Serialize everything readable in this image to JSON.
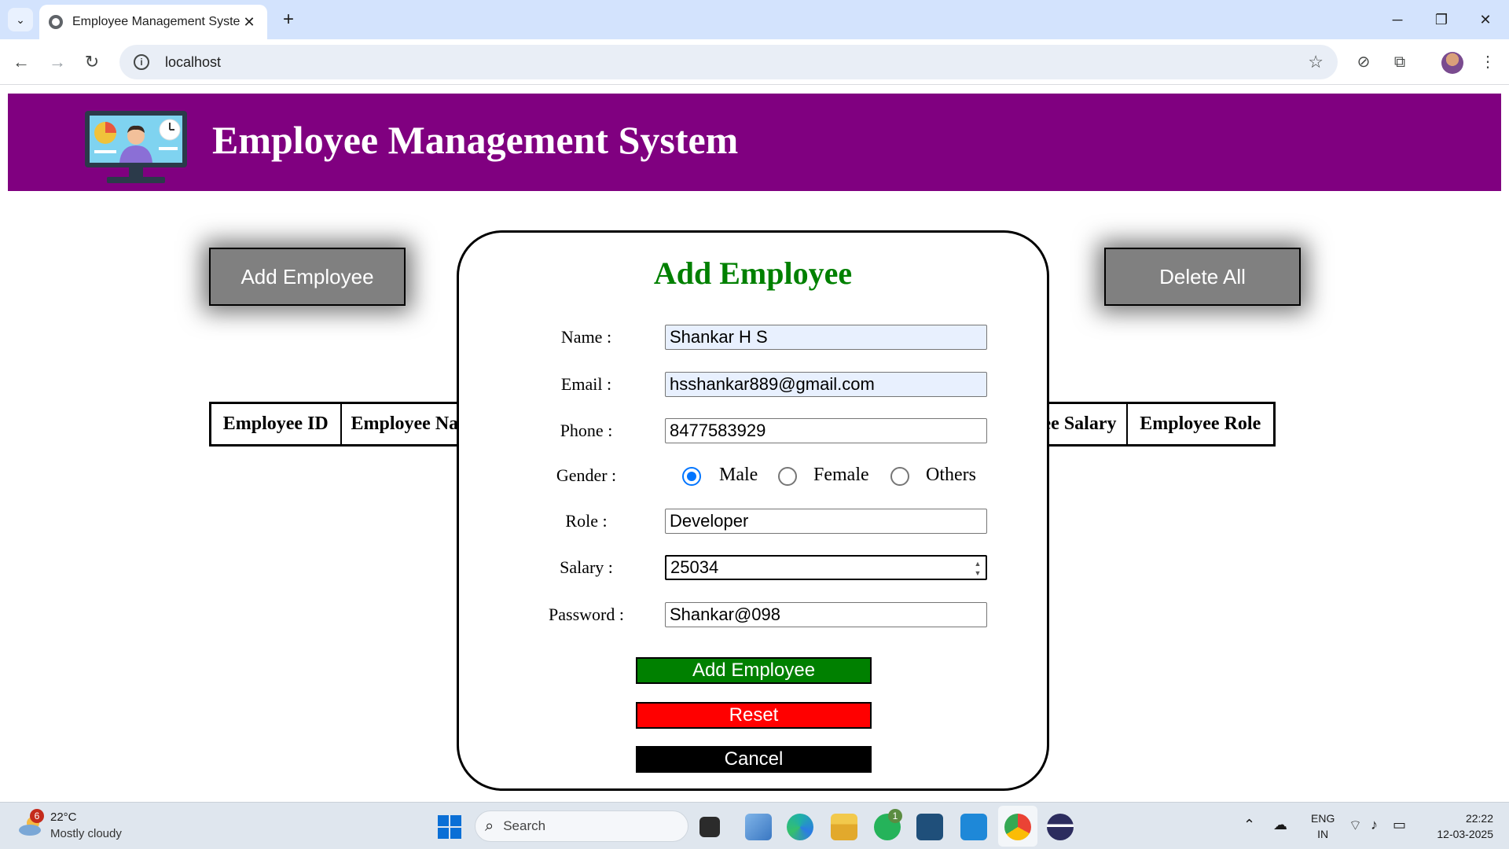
{
  "browser": {
    "tab_title": "Employee Management System",
    "url": "localhost"
  },
  "header": {
    "title": "Employee Management System"
  },
  "actions": {
    "add_label": "Add Employee",
    "delete_all_label": "Delete All"
  },
  "table": {
    "columns": [
      "Employee ID",
      "Employee Na",
      "yee Salary",
      "Employee Role"
    ]
  },
  "modal": {
    "title": "Add Employee",
    "labels": {
      "name": "Name :",
      "email": "Email :",
      "phone": "Phone :",
      "gender": "Gender :",
      "role": "Role :",
      "salary": "Salary :",
      "password": "Password :"
    },
    "values": {
      "name": "Shankar H S",
      "email": "hsshankar889@gmail.com",
      "phone": "8477583929",
      "role": "Developer",
      "salary": "25034",
      "password": "Shankar@098"
    },
    "gender_options": [
      "Male",
      "Female",
      "Others"
    ],
    "gender_selected": "Male",
    "buttons": {
      "submit": "Add Employee",
      "reset": "Reset",
      "cancel": "Cancel"
    },
    "colors": {
      "title": "#008000",
      "submit": "#008000",
      "reset": "#ff0000",
      "cancel": "#000000"
    }
  },
  "colors": {
    "header_bg": "#800080",
    "action_btn_bg": "#808080"
  },
  "taskbar": {
    "weather_temp": "22°C",
    "weather_desc": "Mostly cloudy",
    "weather_badge": "6",
    "search_label": "Search",
    "whatsapp_badge": "1",
    "lang_line1": "ENG",
    "lang_line2": "IN",
    "time": "22:22",
    "date": "12-03-2025"
  }
}
